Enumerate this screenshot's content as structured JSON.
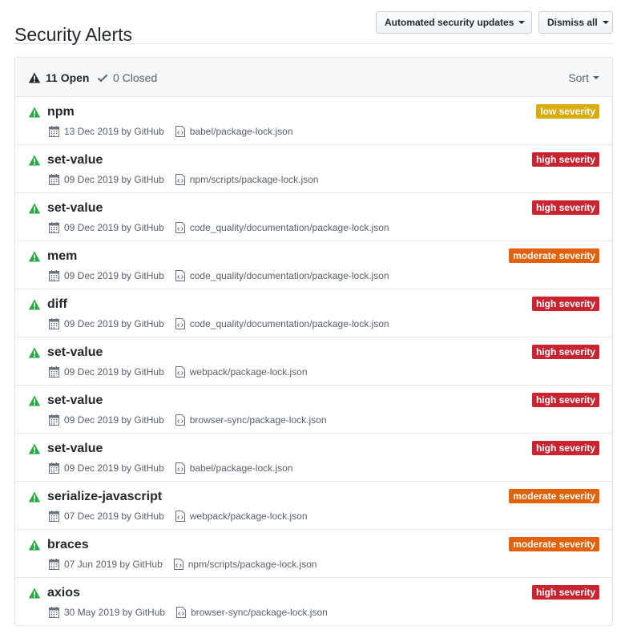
{
  "header": {
    "title": "Security Alerts",
    "automated_button": "Automated security updates",
    "dismiss_button": "Dismiss all"
  },
  "filters": {
    "open_label": "11 Open",
    "closed_label": "0 Closed",
    "sort_label": "Sort"
  },
  "colors": {
    "low": "#dbab09",
    "high": "#cb2431",
    "moderate": "#e36209",
    "alert_icon": "#28a745"
  },
  "alerts": [
    {
      "package": "npm",
      "severity": "low severity",
      "level": "low",
      "date": "13 Dec 2019 by GitHub",
      "path": "babel/package-lock.json"
    },
    {
      "package": "set-value",
      "severity": "high severity",
      "level": "high",
      "date": "09 Dec 2019 by GitHub",
      "path": "npm/scripts/package-lock.json"
    },
    {
      "package": "set-value",
      "severity": "high severity",
      "level": "high",
      "date": "09 Dec 2019 by GitHub",
      "path": "code_quality/documentation/package-lock.json"
    },
    {
      "package": "mem",
      "severity": "moderate severity",
      "level": "moderate",
      "date": "09 Dec 2019 by GitHub",
      "path": "code_quality/documentation/package-lock.json"
    },
    {
      "package": "diff",
      "severity": "high severity",
      "level": "high",
      "date": "09 Dec 2019 by GitHub",
      "path": "code_quality/documentation/package-lock.json"
    },
    {
      "package": "set-value",
      "severity": "high severity",
      "level": "high",
      "date": "09 Dec 2019 by GitHub",
      "path": "webpack/package-lock.json"
    },
    {
      "package": "set-value",
      "severity": "high severity",
      "level": "high",
      "date": "09 Dec 2019 by GitHub",
      "path": "browser-sync/package-lock.json"
    },
    {
      "package": "set-value",
      "severity": "high severity",
      "level": "high",
      "date": "09 Dec 2019 by GitHub",
      "path": "babel/package-lock.json"
    },
    {
      "package": "serialize-javascript",
      "severity": "moderate severity",
      "level": "moderate",
      "date": "07 Dec 2019 by GitHub",
      "path": "webpack/package-lock.json"
    },
    {
      "package": "braces",
      "severity": "moderate severity",
      "level": "moderate",
      "date": "07 Jun 2019 by GitHub",
      "path": "npm/scripts/package-lock.json"
    },
    {
      "package": "axios",
      "severity": "high severity",
      "level": "high",
      "date": "30 May 2019 by GitHub",
      "path": "browser-sync/package-lock.json"
    }
  ]
}
